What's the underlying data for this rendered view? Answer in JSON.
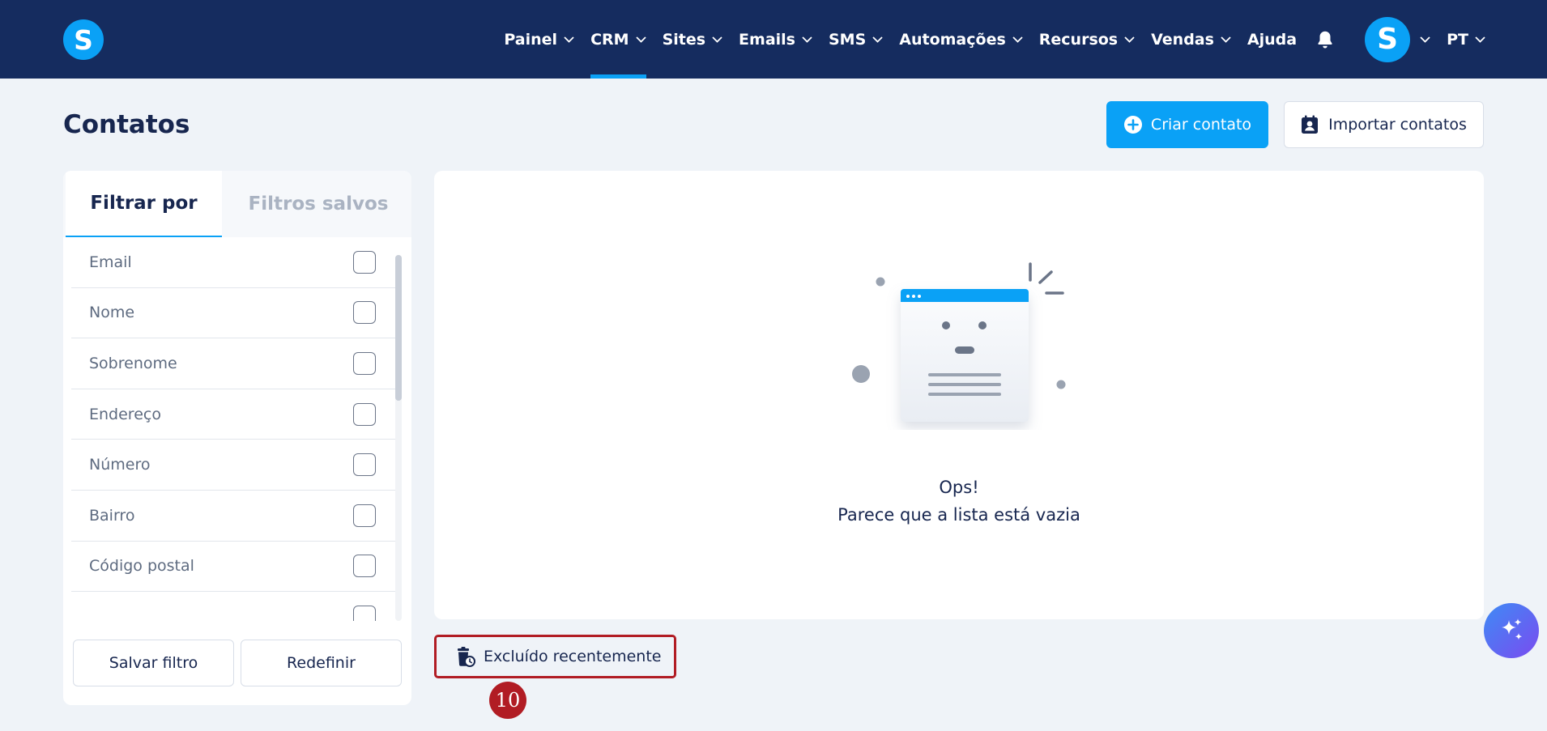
{
  "brand": {
    "logo_letter": "S",
    "accent_color": "#0aa1f6",
    "nav_bg": "#152c5f"
  },
  "nav": {
    "items": [
      {
        "label": "Painel",
        "has_dropdown": true
      },
      {
        "label": "CRM",
        "has_dropdown": true,
        "active": true
      },
      {
        "label": "Sites",
        "has_dropdown": true
      },
      {
        "label": "Emails",
        "has_dropdown": true
      },
      {
        "label": "SMS",
        "has_dropdown": true
      },
      {
        "label": "Automações",
        "has_dropdown": true
      },
      {
        "label": "Recursos",
        "has_dropdown": true
      },
      {
        "label": "Vendas",
        "has_dropdown": true
      },
      {
        "label": "Ajuda",
        "has_dropdown": false
      }
    ],
    "avatar_letter": "S",
    "language": "PT",
    "notification_icon": "bell-icon"
  },
  "page": {
    "title": "Contatos",
    "create_button": "Criar contato",
    "import_button": "Importar contatos"
  },
  "filters": {
    "tabs": [
      "Filtrar por",
      "Filtros salvos"
    ],
    "active_tab": "Filtrar por",
    "items": [
      "Email",
      "Nome",
      "Sobrenome",
      "Endereço",
      "Número",
      "Bairro",
      "Código postal"
    ],
    "save_button": "Salvar filtro",
    "reset_button": "Redefinir"
  },
  "empty_state": {
    "title": "Ops!",
    "message": "Parece que a lista está vazia"
  },
  "recently_deleted": {
    "label": "Excluído recentemente",
    "highlight_color": "#b11c24"
  },
  "step_badge": "10"
}
